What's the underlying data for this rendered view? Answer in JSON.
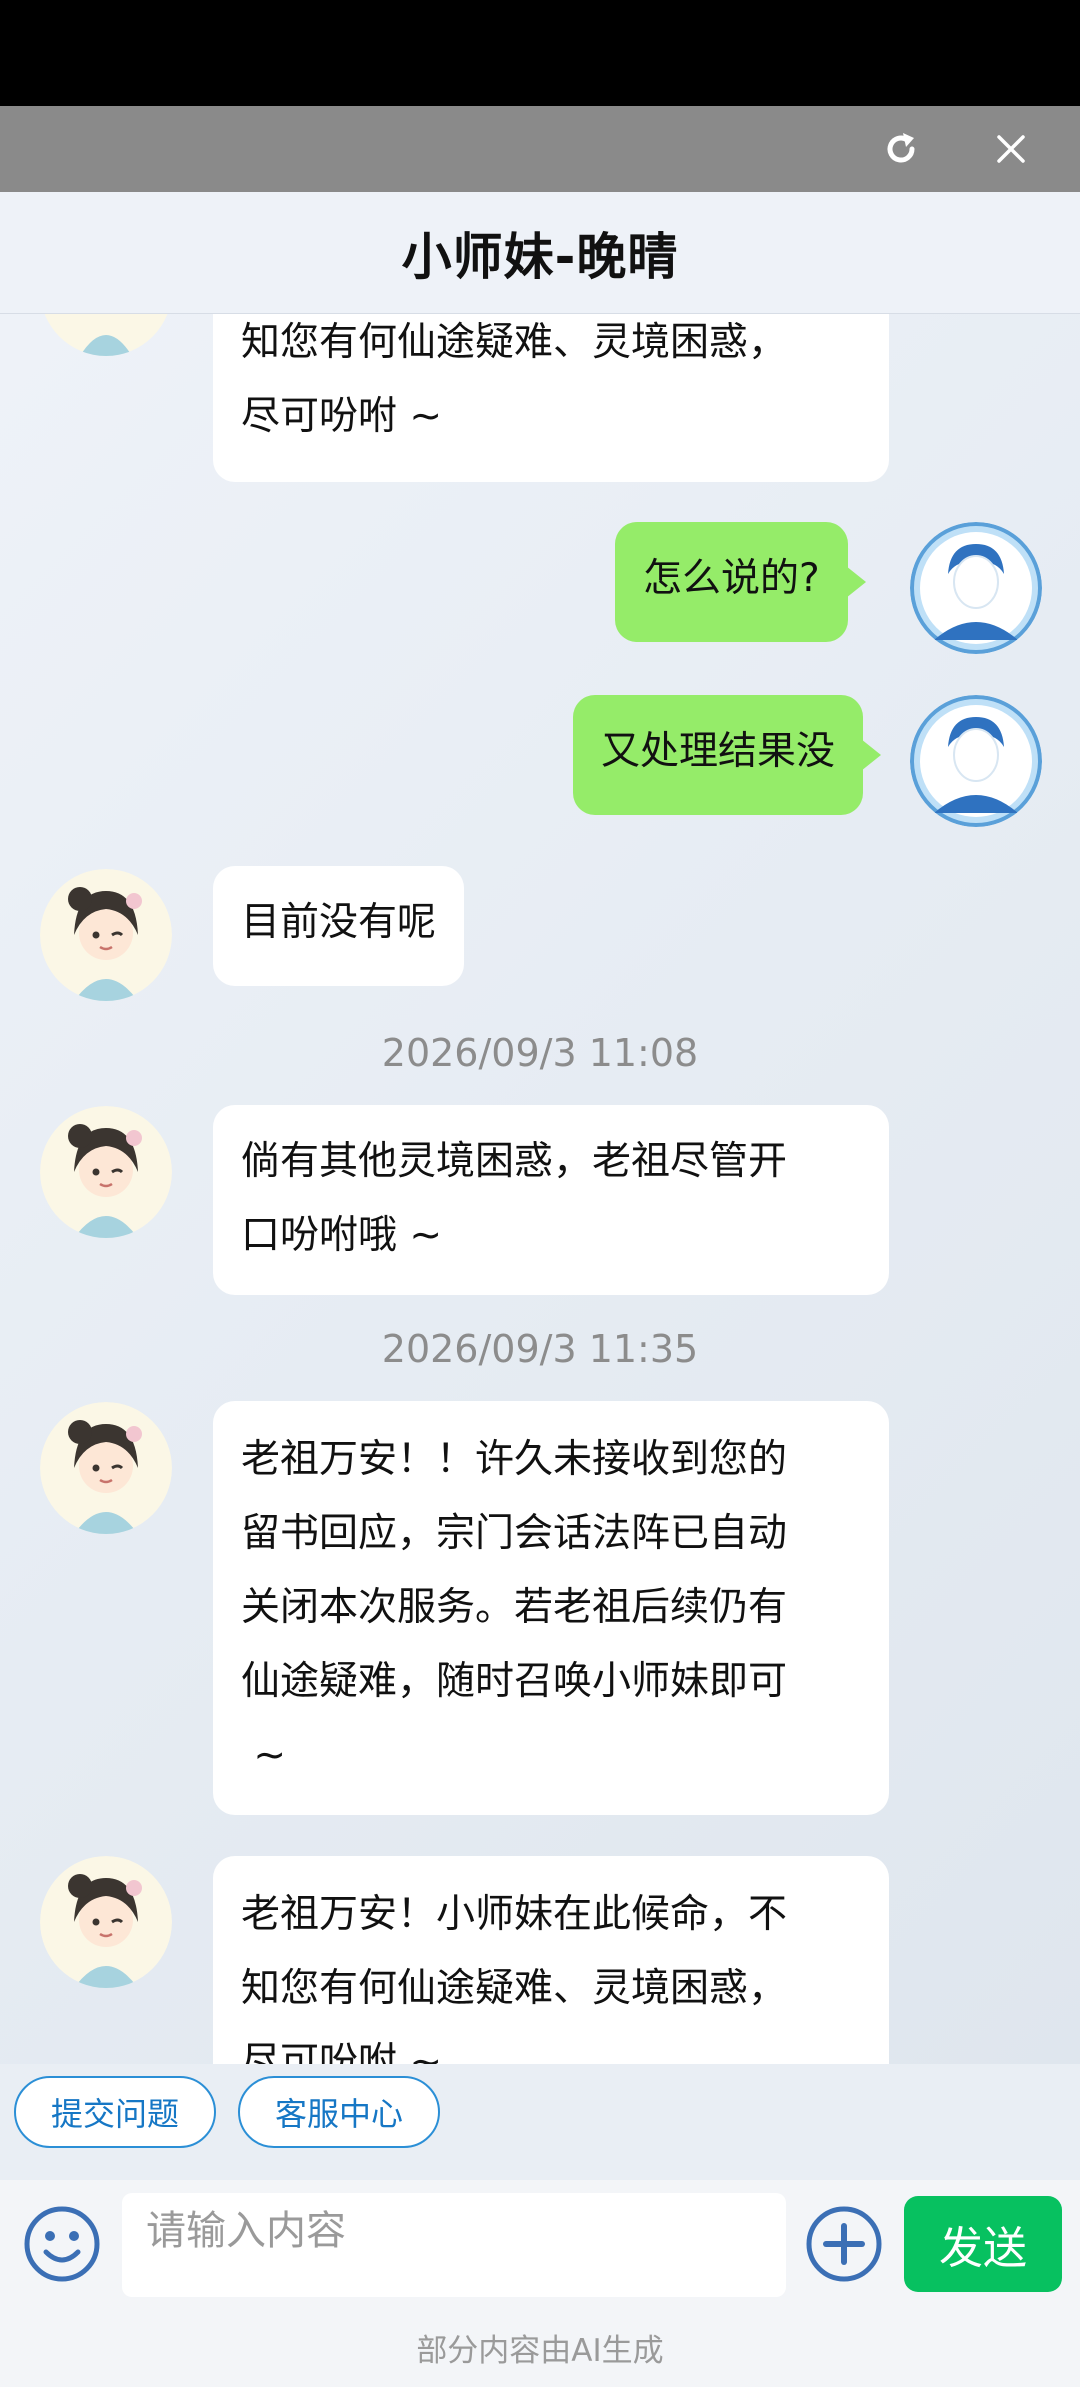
{
  "title": "小师妹-晚晴",
  "messages": [
    {
      "text": "知您有何仙途疑难、灵境困惑，\n尽可吩咐 ~"
    },
    {
      "text": "怎么说的?"
    },
    {
      "text": "又处理结果没"
    },
    {
      "text": "目前没有呢"
    },
    {
      "text": "倘有其他灵境困惑，老祖尽管开\n口吩咐哦 ~"
    },
    {
      "text": "老祖万安！！许久未接收到您的\n留书回应，宗门会话法阵已自动\n关闭本次服务。若老祖后续仍有\n仙途疑难，随时召唤小师妹即可\n ~"
    },
    {
      "text": "老祖万安！小师妹在此候命，不\n知您有何仙途疑难、灵境困惑，\n尽可吩咐 ~"
    }
  ],
  "timestamps": [
    "2026/09/3 11:08",
    "2026/09/3 11:35"
  ],
  "quick_actions": [
    "提交问题",
    "客服中心"
  ],
  "input": {
    "placeholder": "请输入内容",
    "value": ""
  },
  "send_label": "发送",
  "footer_note": "部分内容由AI生成",
  "colors": {
    "user_bubble": "#95ec69",
    "send_button": "#07c160",
    "chip_border": "#2b8fd6"
  }
}
